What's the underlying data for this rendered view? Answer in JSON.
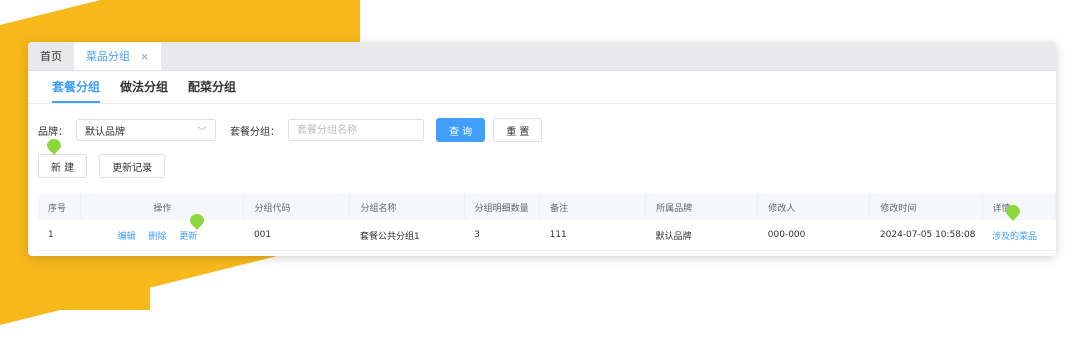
{
  "colors": {
    "accent": "#409EFF",
    "decoration": "#F7B81C",
    "marker": "#8BD63B"
  },
  "tabs": [
    {
      "label": "首页"
    },
    {
      "label": "菜品分组",
      "close": "×"
    }
  ],
  "subtabs": [
    "套餐分组",
    "做法分组",
    "配菜分组"
  ],
  "filters": {
    "brand_label": "品牌：",
    "brand_value": "默认品牌",
    "group_label": "套餐分组：",
    "group_placeholder": "套餐分组名称",
    "query_button": "查 询",
    "reset_button": "重 置"
  },
  "actions": {
    "new_button": "新 建",
    "log_button": "更新记录"
  },
  "table": {
    "headers": [
      "序号",
      "操作",
      "分组代码",
      "分组名称",
      "分组明细数量",
      "备注",
      "所属品牌",
      "修改人",
      "修改时间",
      "详情"
    ],
    "rows": [
      {
        "index": "1",
        "ops": [
          "编辑",
          "删除",
          "更新"
        ],
        "code": "001",
        "name": "套餐公共分组1",
        "count": "3",
        "remark": "111",
        "brand": "默认品牌",
        "modifier": "000-000",
        "modified_time": "2024-07-05 10:58:08",
        "detail": "涉及的菜品"
      }
    ]
  }
}
